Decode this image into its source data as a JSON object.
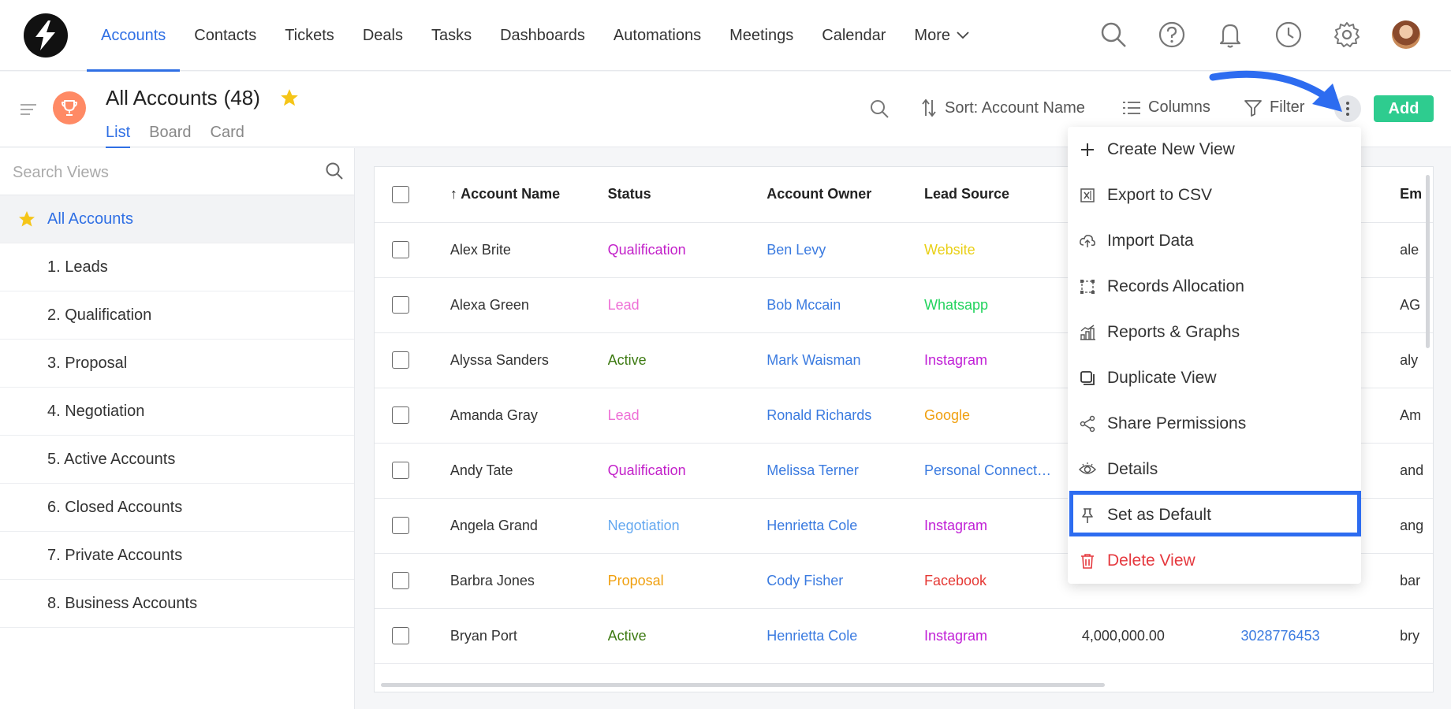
{
  "nav": {
    "items": [
      {
        "label": "Accounts",
        "active": true
      },
      {
        "label": "Contacts"
      },
      {
        "label": "Tickets"
      },
      {
        "label": "Deals"
      },
      {
        "label": "Tasks"
      },
      {
        "label": "Dashboards"
      },
      {
        "label": "Automations"
      },
      {
        "label": "Meetings"
      },
      {
        "label": "Calendar"
      }
    ],
    "more_label": "More",
    "icons": [
      "search-icon",
      "help-icon",
      "bell-icon",
      "clock-icon",
      "gear-icon"
    ]
  },
  "header": {
    "title": "All Accounts",
    "count": "(48)",
    "tabs": [
      "List",
      "Board",
      "Card"
    ],
    "active_tab": "List",
    "sort_label": "Sort: Account Name",
    "columns_label": "Columns",
    "filter_label": "Filter",
    "add_label": "Add"
  },
  "sidebar": {
    "search_placeholder": "Search Views",
    "views": [
      {
        "label": "All Accounts",
        "active": true,
        "starred": true
      },
      {
        "label": "1. Leads"
      },
      {
        "label": "2. Qualification"
      },
      {
        "label": "3. Proposal"
      },
      {
        "label": "4. Negotiation"
      },
      {
        "label": "5. Active Accounts"
      },
      {
        "label": "6. Closed Accounts"
      },
      {
        "label": "7. Private Accounts"
      },
      {
        "label": "8. Business Accounts"
      }
    ]
  },
  "table": {
    "headers": [
      "Account Name",
      "Status",
      "Account Owner",
      "Lead Source",
      "",
      "",
      "Em"
    ],
    "rows": [
      {
        "name": "Alex Brite",
        "status": "Qualification",
        "owner": "Ben Levy",
        "source": "Website",
        "value": "",
        "phone": "",
        "email": "ale"
      },
      {
        "name": "Alexa Green",
        "status": "Lead",
        "owner": "Bob Mccain",
        "source": "Whatsapp",
        "value": "",
        "phone": "",
        "email": "AG"
      },
      {
        "name": "Alyssa Sanders",
        "status": "Active",
        "owner": "Mark Waisman",
        "source": "Instagram",
        "value": "",
        "phone": "",
        "email": "aly"
      },
      {
        "name": "Amanda Gray",
        "status": "Lead",
        "owner": "Ronald Richards",
        "source": "Google",
        "value": "",
        "phone": "",
        "email": "Am"
      },
      {
        "name": "Andy Tate",
        "status": "Qualification",
        "owner": "Melissa Terner",
        "source": "Personal Connect…",
        "value": "",
        "phone": "",
        "email": "and"
      },
      {
        "name": "Angela Grand",
        "status": "Negotiation",
        "owner": "Henrietta Cole",
        "source": "Instagram",
        "value": "",
        "phone": "",
        "email": "ang"
      },
      {
        "name": "Barbra Jones",
        "status": "Proposal",
        "owner": "Cody Fisher",
        "source": "Facebook",
        "value": "",
        "phone": "",
        "email": "bar"
      },
      {
        "name": "Bryan Port",
        "status": "Active",
        "owner": "Henrietta Cole",
        "source": "Instagram",
        "value": "4,000,000.00",
        "phone": "3028776453",
        "email": "bry"
      }
    ]
  },
  "menu": {
    "items": [
      {
        "label": "Create New View",
        "icon": "plus-icon"
      },
      {
        "label": "Export to CSV",
        "icon": "excel-icon"
      },
      {
        "label": "Import Data",
        "icon": "cloud-upload-icon"
      },
      {
        "label": "Records Allocation",
        "icon": "allocation-icon"
      },
      {
        "label": "Reports & Graphs",
        "icon": "chart-icon"
      },
      {
        "label": "Duplicate View",
        "icon": "duplicate-icon"
      },
      {
        "label": "Share Permissions",
        "icon": "share-icon"
      },
      {
        "label": "Details",
        "icon": "eye-icon"
      },
      {
        "label": "Set as Default",
        "icon": "pin-icon",
        "highlighted": true
      },
      {
        "label": "Delete View",
        "icon": "trash-icon",
        "danger": true
      }
    ]
  },
  "colors": {
    "accent": "#2f6fe4",
    "add_button": "#2ecc8f",
    "danger": "#e5393f",
    "highlight_box": "#2d6cf0",
    "status": {
      "Qualification": "#c21fc9",
      "Lead": "#ee6fd6",
      "Active": "#3d7a12",
      "Negotiation": "#64a8f0",
      "Proposal": "#f0a010"
    },
    "source": {
      "Website": "#e9cf14",
      "Whatsapp": "#21d35d",
      "Instagram": "#c01fd6",
      "Google": "#f0a010",
      "Personal Connect…": "#3b7be0",
      "Facebook": "#e53935"
    },
    "owner": "#3b7be0"
  }
}
